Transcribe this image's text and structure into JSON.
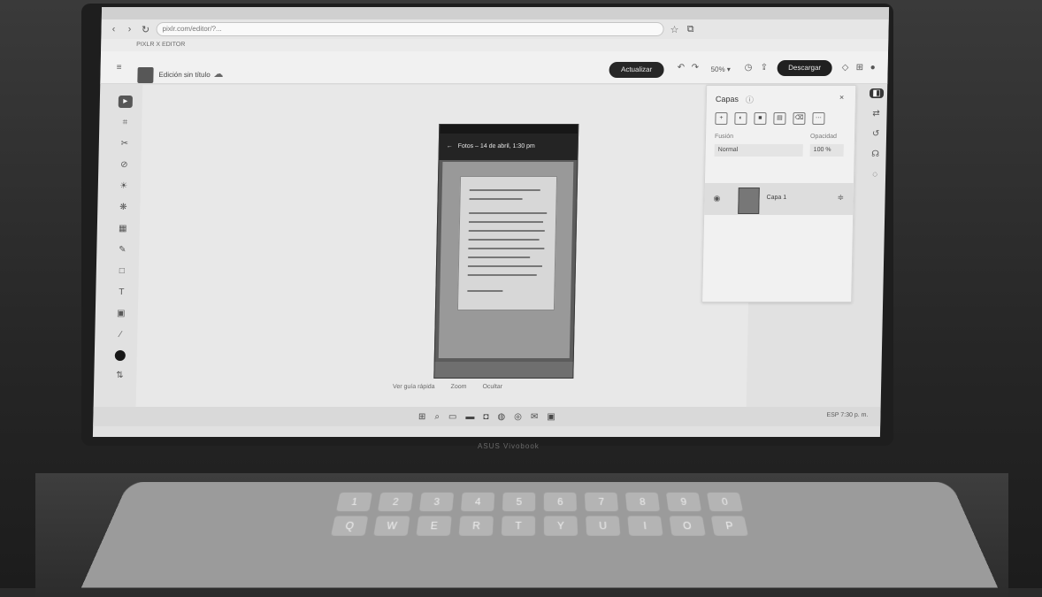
{
  "browser": {
    "address": "pixlr.com/editor/?...",
    "bookmark": "PIXLR X EDITOR"
  },
  "app": {
    "doc_title": "Edición sin título",
    "upgrade_label": "Actualizar",
    "zoom_label": "50% ▾",
    "download_label": "Descargar"
  },
  "phone": {
    "header_text": "Fotos – 14 de abril, 1:30 pm"
  },
  "canvas_actions": {
    "action1": "Ver guía rápida",
    "action2": "Zoom",
    "action3": "Ocultar"
  },
  "layers_panel": {
    "title": "Capas",
    "blend_label": "Fusión",
    "opacity_label": "Opacidad",
    "blend_value": "Normal",
    "opacity_value": "100 %",
    "layer_name": "Capa 1"
  },
  "taskbar": {
    "tray_text": "ESP 7:30 p. m."
  },
  "brand": "ASUS Vivobook",
  "keyboard": {
    "row1": [
      "1",
      "2",
      "3",
      "4",
      "5",
      "6",
      "7",
      "8",
      "9",
      "0"
    ],
    "row2": [
      "Q",
      "W",
      "E",
      "R",
      "T",
      "Y",
      "U",
      "I",
      "O",
      "P"
    ]
  }
}
